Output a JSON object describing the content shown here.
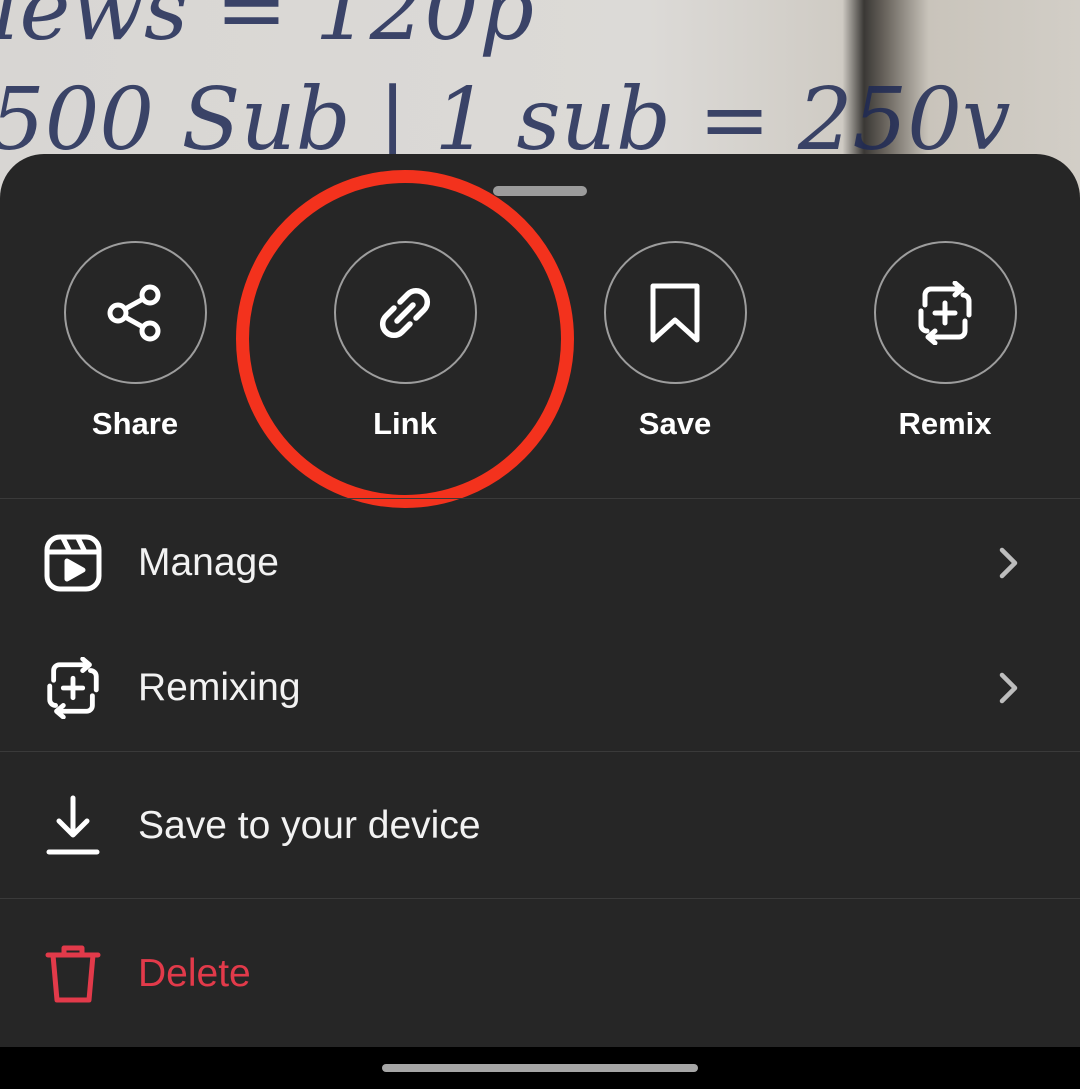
{
  "background": {
    "line1": "iews = 120p",
    "line2": "500 Sub | 1 sub = 250v"
  },
  "actions": [
    {
      "label": "Share",
      "icon": "share-icon"
    },
    {
      "label": "Link",
      "icon": "link-icon"
    },
    {
      "label": "Save",
      "icon": "bookmark-icon"
    },
    {
      "label": "Remix",
      "icon": "remix-icon"
    }
  ],
  "menu": [
    {
      "label": "Manage",
      "icon": "reels-icon",
      "chevron": true
    },
    {
      "label": "Remixing",
      "icon": "remix-icon",
      "chevron": true
    },
    {
      "label": "Save to your device",
      "icon": "download-icon",
      "chevron": false
    },
    {
      "label": "Delete",
      "icon": "trash-icon",
      "chevron": false
    }
  ],
  "colors": {
    "sheet": "#262626",
    "highlight": "#f3321d",
    "danger": "#e23a4a"
  }
}
